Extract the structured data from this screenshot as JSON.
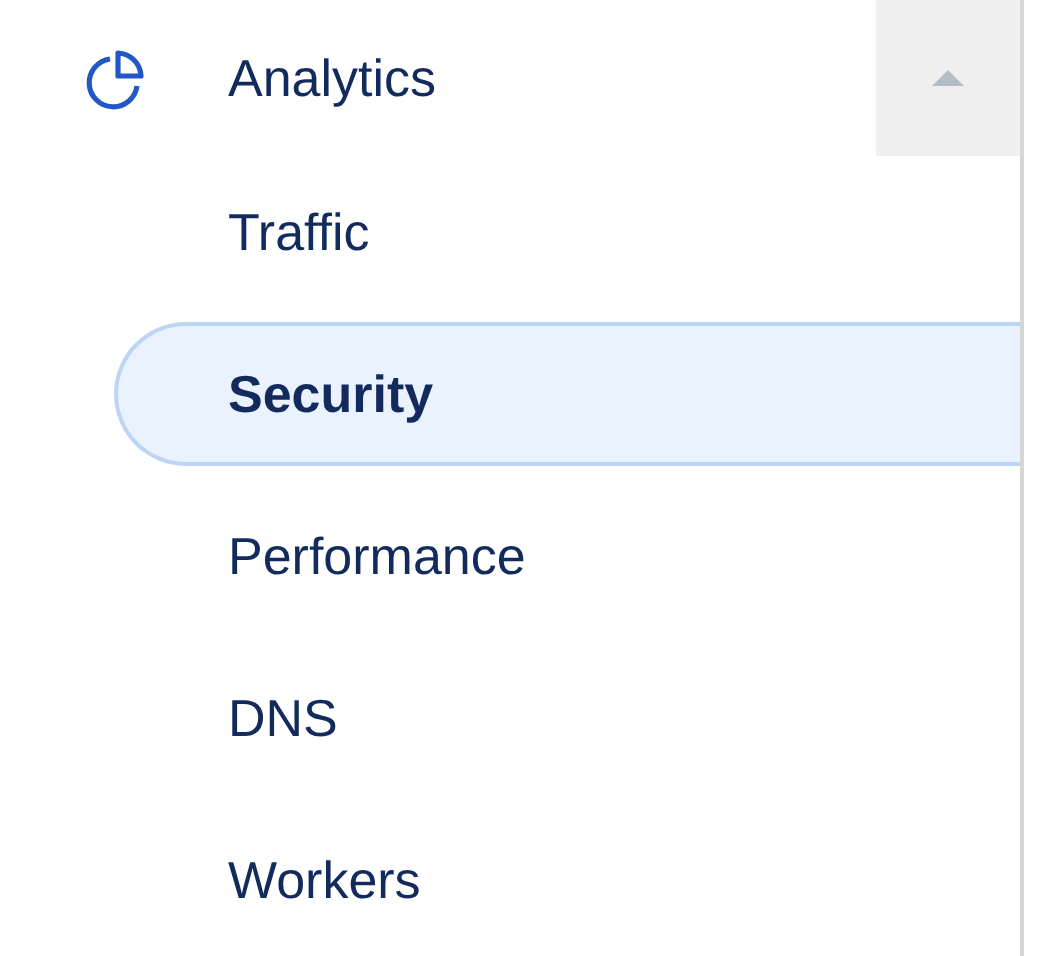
{
  "nav": {
    "section": {
      "label": "Analytics",
      "expanded": true
    },
    "items": [
      {
        "label": "Traffic",
        "selected": false
      },
      {
        "label": "Security",
        "selected": true
      },
      {
        "label": "Performance",
        "selected": false
      },
      {
        "label": "DNS",
        "selected": false
      },
      {
        "label": "Workers",
        "selected": false
      }
    ]
  }
}
